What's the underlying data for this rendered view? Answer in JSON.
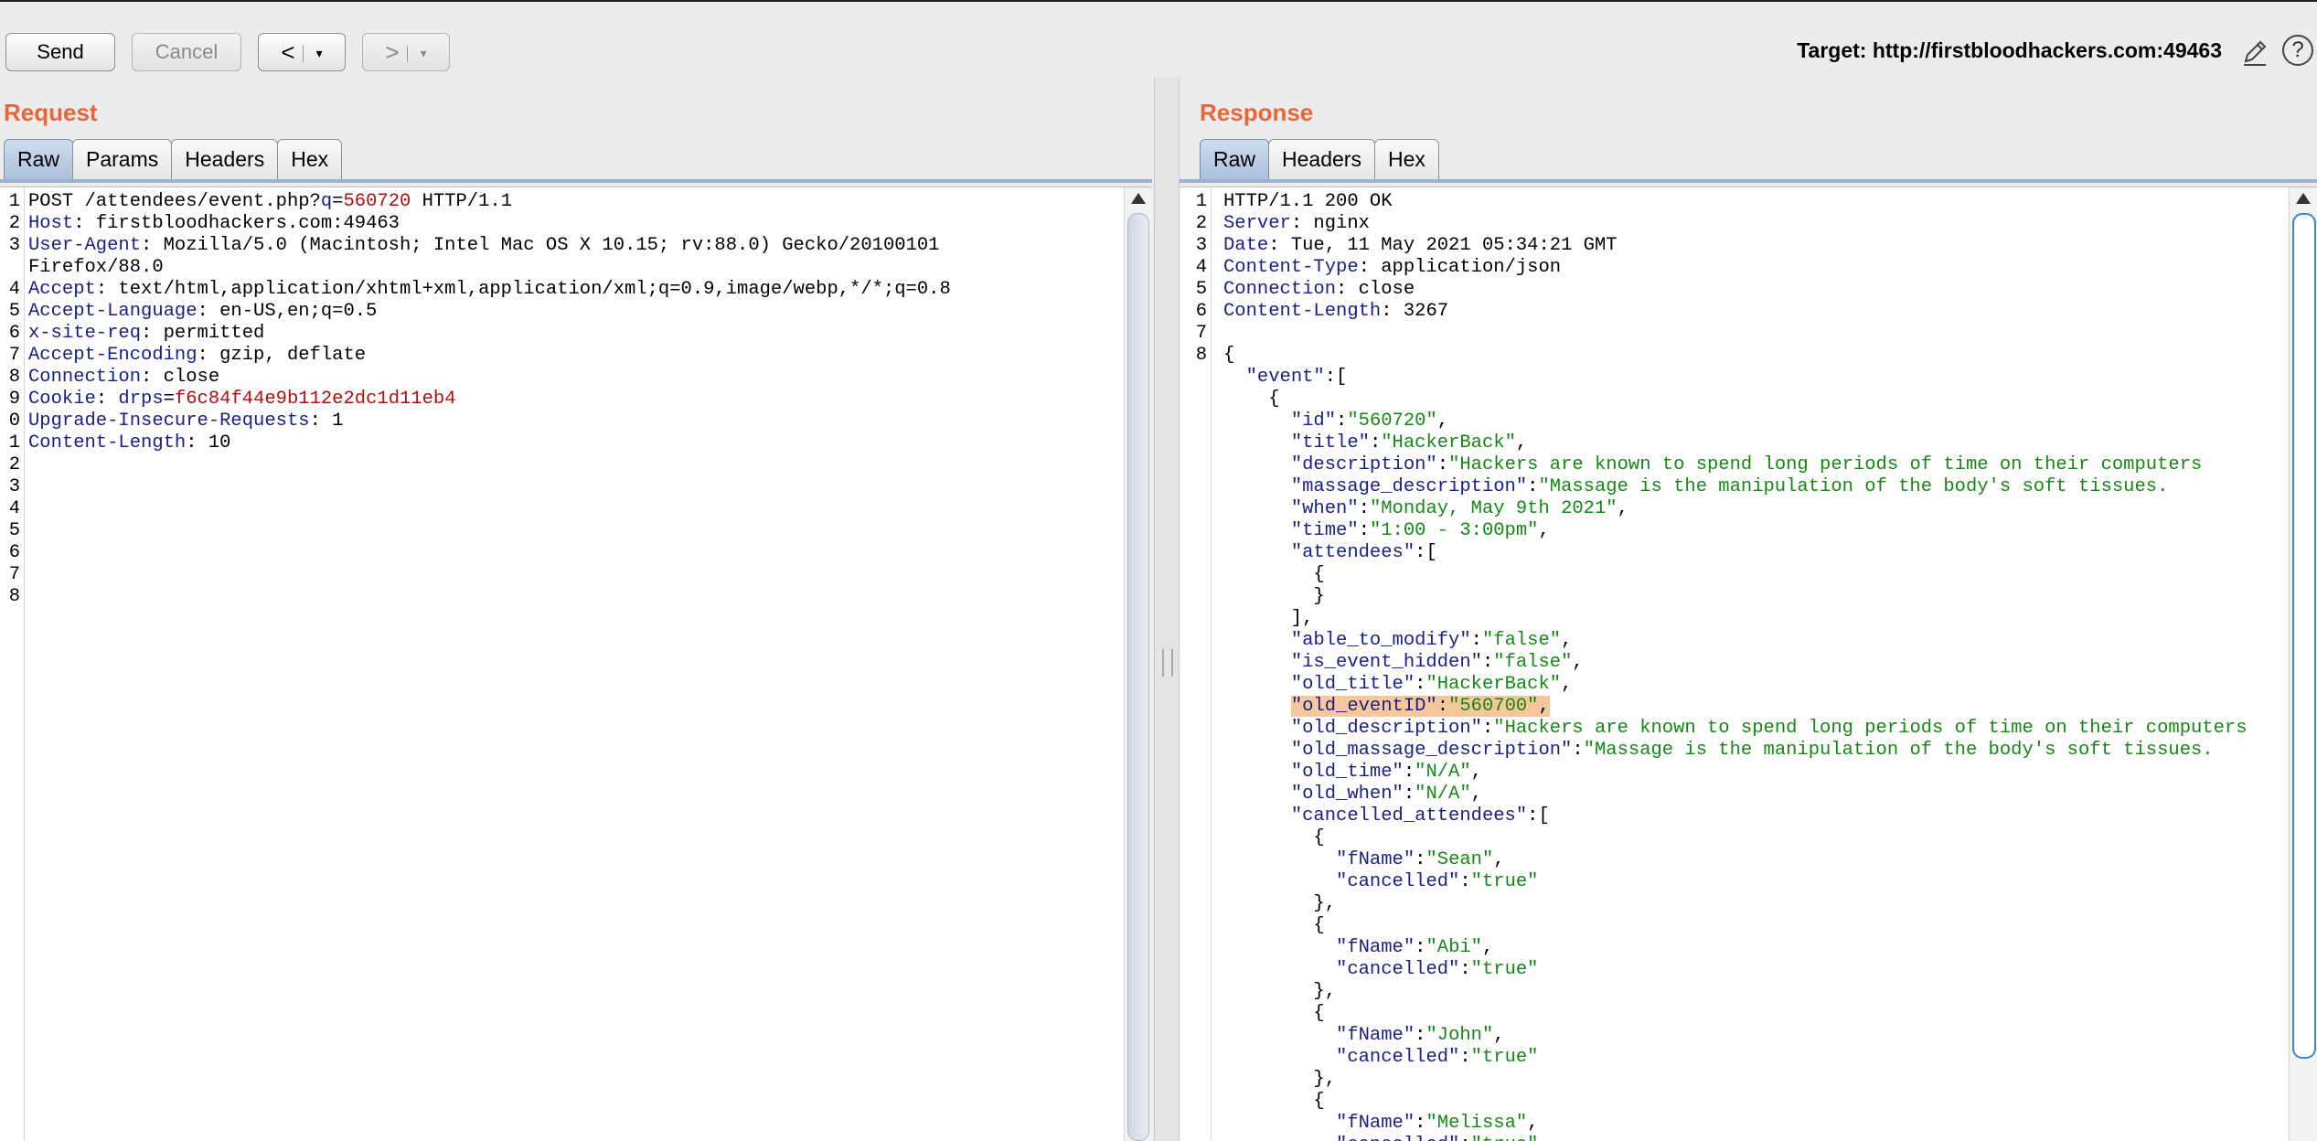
{
  "toolbar": {
    "send_label": "Send",
    "cancel_label": "Cancel",
    "back_label": "<",
    "forward_label": ">",
    "dropdown_glyph": "▾",
    "target_label": "Target: http://firstbloodhackers.com:49463"
  },
  "request": {
    "title": "Request",
    "tabs": [
      "Raw",
      "Params",
      "Headers",
      "Hex"
    ],
    "lines": [
      [
        [
          "1",
          "ln"
        ],
        [
          "POST /attendees/event.php?",
          ""
        ],
        [
          "q",
          "k"
        ],
        [
          "=",
          ""
        ],
        [
          "560720",
          "v"
        ],
        [
          " HTTP/1.1",
          ""
        ]
      ],
      [
        [
          "2",
          "ln"
        ],
        [
          "Host",
          "k"
        ],
        [
          ": firstbloodhackers.com:49463",
          ""
        ]
      ],
      [
        [
          "3",
          "ln"
        ],
        [
          "User-Agent",
          "k"
        ],
        [
          ": Mozilla/5.0 (Macintosh; Intel Mac OS X 10.15; rv:88.0) Gecko/20100101",
          ""
        ]
      ],
      [
        [
          "",
          "ln"
        ],
        [
          "Firefox/88.0",
          ""
        ]
      ],
      [
        [
          "4",
          "ln"
        ],
        [
          "Accept",
          "k"
        ],
        [
          ": text/html,application/xhtml+xml,application/xml;q=0.9,image/webp,*/*;q=0.8",
          ""
        ]
      ],
      [
        [
          "5",
          "ln"
        ],
        [
          "Accept-Language",
          "k"
        ],
        [
          ": en-US,en;q=0.5",
          ""
        ]
      ],
      [
        [
          "6",
          "ln"
        ],
        [
          "x-site-req",
          "k"
        ],
        [
          ": permitted",
          ""
        ]
      ],
      [
        [
          "7",
          "ln"
        ],
        [
          "Accept-Encoding",
          "k"
        ],
        [
          ": gzip, deflate",
          ""
        ]
      ],
      [
        [
          "8",
          "ln"
        ],
        [
          "Connection",
          "k"
        ],
        [
          ": close",
          ""
        ]
      ],
      [
        [
          "9",
          "ln"
        ],
        [
          "Cookie",
          "k"
        ],
        [
          ": ",
          ""
        ],
        [
          "drps",
          "k"
        ],
        [
          "=",
          ""
        ],
        [
          "f6c84f44e9b112e2dc1d11eb4",
          "v"
        ]
      ],
      [
        [
          "0",
          "ln"
        ],
        [
          "Upgrade-Insecure-Requests",
          "k"
        ],
        [
          ": 1",
          ""
        ]
      ],
      [
        [
          "1",
          "ln"
        ],
        [
          "Content-Length",
          "k"
        ],
        [
          ": 10",
          ""
        ]
      ],
      [
        [
          "2",
          "ln"
        ]
      ],
      [
        [
          "3",
          "ln"
        ]
      ],
      [
        [
          "4",
          "ln"
        ]
      ],
      [
        [
          "5",
          "ln"
        ]
      ],
      [
        [
          "6",
          "ln"
        ]
      ],
      [
        [
          "7",
          "ln"
        ]
      ],
      [
        [
          "8",
          "ln"
        ]
      ]
    ]
  },
  "response": {
    "title": "Response",
    "tabs": [
      "Raw",
      "Headers",
      "Hex"
    ],
    "lines": [
      [
        [
          "1",
          "ln"
        ],
        [
          "HTTP/1.1 200 OK",
          ""
        ]
      ],
      [
        [
          "2",
          "ln"
        ],
        [
          "Server",
          "k"
        ],
        [
          ": nginx",
          ""
        ]
      ],
      [
        [
          "3",
          "ln"
        ],
        [
          "Date",
          "k"
        ],
        [
          ": Tue, 11 May 2021 05:34:21 GMT",
          ""
        ]
      ],
      [
        [
          "4",
          "ln"
        ],
        [
          "Content-Type",
          "k"
        ],
        [
          ": application/json",
          ""
        ]
      ],
      [
        [
          "5",
          "ln"
        ],
        [
          "Connection",
          "k"
        ],
        [
          ": close",
          ""
        ]
      ],
      [
        [
          "6",
          "ln"
        ],
        [
          "Content-Length",
          "k"
        ],
        [
          ": 3267",
          ""
        ]
      ],
      [
        [
          "7",
          "ln"
        ]
      ],
      [
        [
          "8",
          "ln"
        ],
        [
          "{",
          ""
        ]
      ],
      [
        [
          "",
          "ln"
        ],
        [
          "  ",
          ""
        ],
        [
          "\"event\"",
          "k"
        ],
        [
          ":[",
          ""
        ]
      ],
      [
        [
          "",
          "ln"
        ],
        [
          "    {",
          ""
        ]
      ],
      [
        [
          "",
          "ln"
        ],
        [
          "      ",
          ""
        ],
        [
          "\"id\"",
          "k"
        ],
        [
          ":",
          ""
        ],
        [
          "\"560720\"",
          "s"
        ],
        [
          ",",
          ""
        ]
      ],
      [
        [
          "",
          "ln"
        ],
        [
          "      ",
          ""
        ],
        [
          "\"title\"",
          "k"
        ],
        [
          ":",
          ""
        ],
        [
          "\"HackerBack\"",
          "s"
        ],
        [
          ",",
          ""
        ]
      ],
      [
        [
          "",
          "ln"
        ],
        [
          "      ",
          ""
        ],
        [
          "\"description\"",
          "k"
        ],
        [
          ":",
          ""
        ],
        [
          "\"Hackers are known to spend long periods of time on their computers",
          "s"
        ]
      ],
      [
        [
          "",
          "ln"
        ],
        [
          "      ",
          ""
        ],
        [
          "\"massage_description\"",
          "k"
        ],
        [
          ":",
          ""
        ],
        [
          "\"Massage is the manipulation of the body's soft tissues.",
          "s"
        ]
      ],
      [
        [
          "",
          "ln"
        ],
        [
          "      ",
          ""
        ],
        [
          "\"when\"",
          "k"
        ],
        [
          ":",
          ""
        ],
        [
          "\"Monday, May 9th 2021\"",
          "s"
        ],
        [
          ",",
          ""
        ]
      ],
      [
        [
          "",
          "ln"
        ],
        [
          "      ",
          ""
        ],
        [
          "\"time\"",
          "k"
        ],
        [
          ":",
          ""
        ],
        [
          "\"1:00 - 3:00pm\"",
          "s"
        ],
        [
          ",",
          ""
        ]
      ],
      [
        [
          "",
          "ln"
        ],
        [
          "      ",
          ""
        ],
        [
          "\"attendees\"",
          "k"
        ],
        [
          ":[",
          ""
        ]
      ],
      [
        [
          "",
          "ln"
        ],
        [
          "        {",
          ""
        ]
      ],
      [
        [
          "",
          "ln"
        ],
        [
          "        }",
          ""
        ]
      ],
      [
        [
          "",
          "ln"
        ],
        [
          "      ],",
          ""
        ]
      ],
      [
        [
          "",
          "ln"
        ],
        [
          "      ",
          ""
        ],
        [
          "\"able_to_modify\"",
          "k"
        ],
        [
          ":",
          ""
        ],
        [
          "\"false\"",
          "s"
        ],
        [
          ",",
          ""
        ]
      ],
      [
        [
          "",
          "ln"
        ],
        [
          "      ",
          ""
        ],
        [
          "\"is_event_hidden\"",
          "k"
        ],
        [
          ":",
          ""
        ],
        [
          "\"false\"",
          "s"
        ],
        [
          ",",
          ""
        ]
      ],
      [
        [
          "",
          "ln"
        ],
        [
          "      ",
          ""
        ],
        [
          "\"old_title\"",
          "k"
        ],
        [
          ":",
          ""
        ],
        [
          "\"HackerBack\"",
          "s"
        ],
        [
          ",",
          ""
        ]
      ],
      [
        [
          "",
          "ln"
        ],
        [
          "      ",
          ""
        ],
        [
          "\"old_eventID\"",
          "k hl"
        ],
        [
          ":",
          "hl"
        ],
        [
          "\"560700\"",
          "s hl"
        ],
        [
          ",",
          "hl"
        ]
      ],
      [
        [
          "",
          "ln"
        ],
        [
          "      ",
          ""
        ],
        [
          "\"old_description\"",
          "k"
        ],
        [
          ":",
          ""
        ],
        [
          "\"Hackers are known to spend long periods of time on their computers",
          "s"
        ]
      ],
      [
        [
          "",
          "ln"
        ],
        [
          "      ",
          ""
        ],
        [
          "\"old_massage_description\"",
          "k"
        ],
        [
          ":",
          ""
        ],
        [
          "\"Massage is the manipulation of the body's soft tissues.",
          "s"
        ]
      ],
      [
        [
          "",
          "ln"
        ],
        [
          "      ",
          ""
        ],
        [
          "\"old_time\"",
          "k"
        ],
        [
          ":",
          ""
        ],
        [
          "\"N/A\"",
          "s"
        ],
        [
          ",",
          ""
        ]
      ],
      [
        [
          "",
          "ln"
        ],
        [
          "      ",
          ""
        ],
        [
          "\"old_when\"",
          "k"
        ],
        [
          ":",
          ""
        ],
        [
          "\"N/A\"",
          "s"
        ],
        [
          ",",
          ""
        ]
      ],
      [
        [
          "",
          "ln"
        ],
        [
          "      ",
          ""
        ],
        [
          "\"cancelled_attendees\"",
          "k"
        ],
        [
          ":[",
          ""
        ]
      ],
      [
        [
          "",
          "ln"
        ],
        [
          "        {",
          ""
        ]
      ],
      [
        [
          "",
          "ln"
        ],
        [
          "          ",
          ""
        ],
        [
          "\"fName\"",
          "k"
        ],
        [
          ":",
          ""
        ],
        [
          "\"Sean\"",
          "s"
        ],
        [
          ",",
          ""
        ]
      ],
      [
        [
          "",
          "ln"
        ],
        [
          "          ",
          ""
        ],
        [
          "\"cancelled\"",
          "k"
        ],
        [
          ":",
          ""
        ],
        [
          "\"true\"",
          "s"
        ]
      ],
      [
        [
          "",
          "ln"
        ],
        [
          "        },",
          ""
        ]
      ],
      [
        [
          "",
          "ln"
        ],
        [
          "        {",
          ""
        ]
      ],
      [
        [
          "",
          "ln"
        ],
        [
          "          ",
          ""
        ],
        [
          "\"fName\"",
          "k"
        ],
        [
          ":",
          ""
        ],
        [
          "\"Abi\"",
          "s"
        ],
        [
          ",",
          ""
        ]
      ],
      [
        [
          "",
          "ln"
        ],
        [
          "          ",
          ""
        ],
        [
          "\"cancelled\"",
          "k"
        ],
        [
          ":",
          ""
        ],
        [
          "\"true\"",
          "s"
        ]
      ],
      [
        [
          "",
          "ln"
        ],
        [
          "        },",
          ""
        ]
      ],
      [
        [
          "",
          "ln"
        ],
        [
          "        {",
          ""
        ]
      ],
      [
        [
          "",
          "ln"
        ],
        [
          "          ",
          ""
        ],
        [
          "\"fName\"",
          "k"
        ],
        [
          ":",
          ""
        ],
        [
          "\"John\"",
          "s"
        ],
        [
          ",",
          ""
        ]
      ],
      [
        [
          "",
          "ln"
        ],
        [
          "          ",
          ""
        ],
        [
          "\"cancelled\"",
          "k"
        ],
        [
          ":",
          ""
        ],
        [
          "\"true\"",
          "s"
        ]
      ],
      [
        [
          "",
          "ln"
        ],
        [
          "        },",
          ""
        ]
      ],
      [
        [
          "",
          "ln"
        ],
        [
          "        {",
          ""
        ]
      ],
      [
        [
          "",
          "ln"
        ],
        [
          "          ",
          ""
        ],
        [
          "\"fName\"",
          "k"
        ],
        [
          ":",
          ""
        ],
        [
          "\"Melissa\"",
          "s"
        ],
        [
          ",",
          ""
        ]
      ],
      [
        [
          "",
          "ln"
        ],
        [
          "          ",
          ""
        ],
        [
          "\"cancelled\"",
          "k"
        ],
        [
          ":",
          ""
        ],
        [
          "\"true\"",
          "s"
        ]
      ]
    ]
  },
  "icons": [
    "pencil-icon",
    "help-icon",
    "scroll-up-icon"
  ],
  "colors": {
    "section_title": "#e8663a",
    "header_key": "#18218a",
    "param_value": "#b30d0d",
    "json_string": "#138913",
    "highlight": "#f7c79c",
    "active_tab": "#aac0dc"
  }
}
